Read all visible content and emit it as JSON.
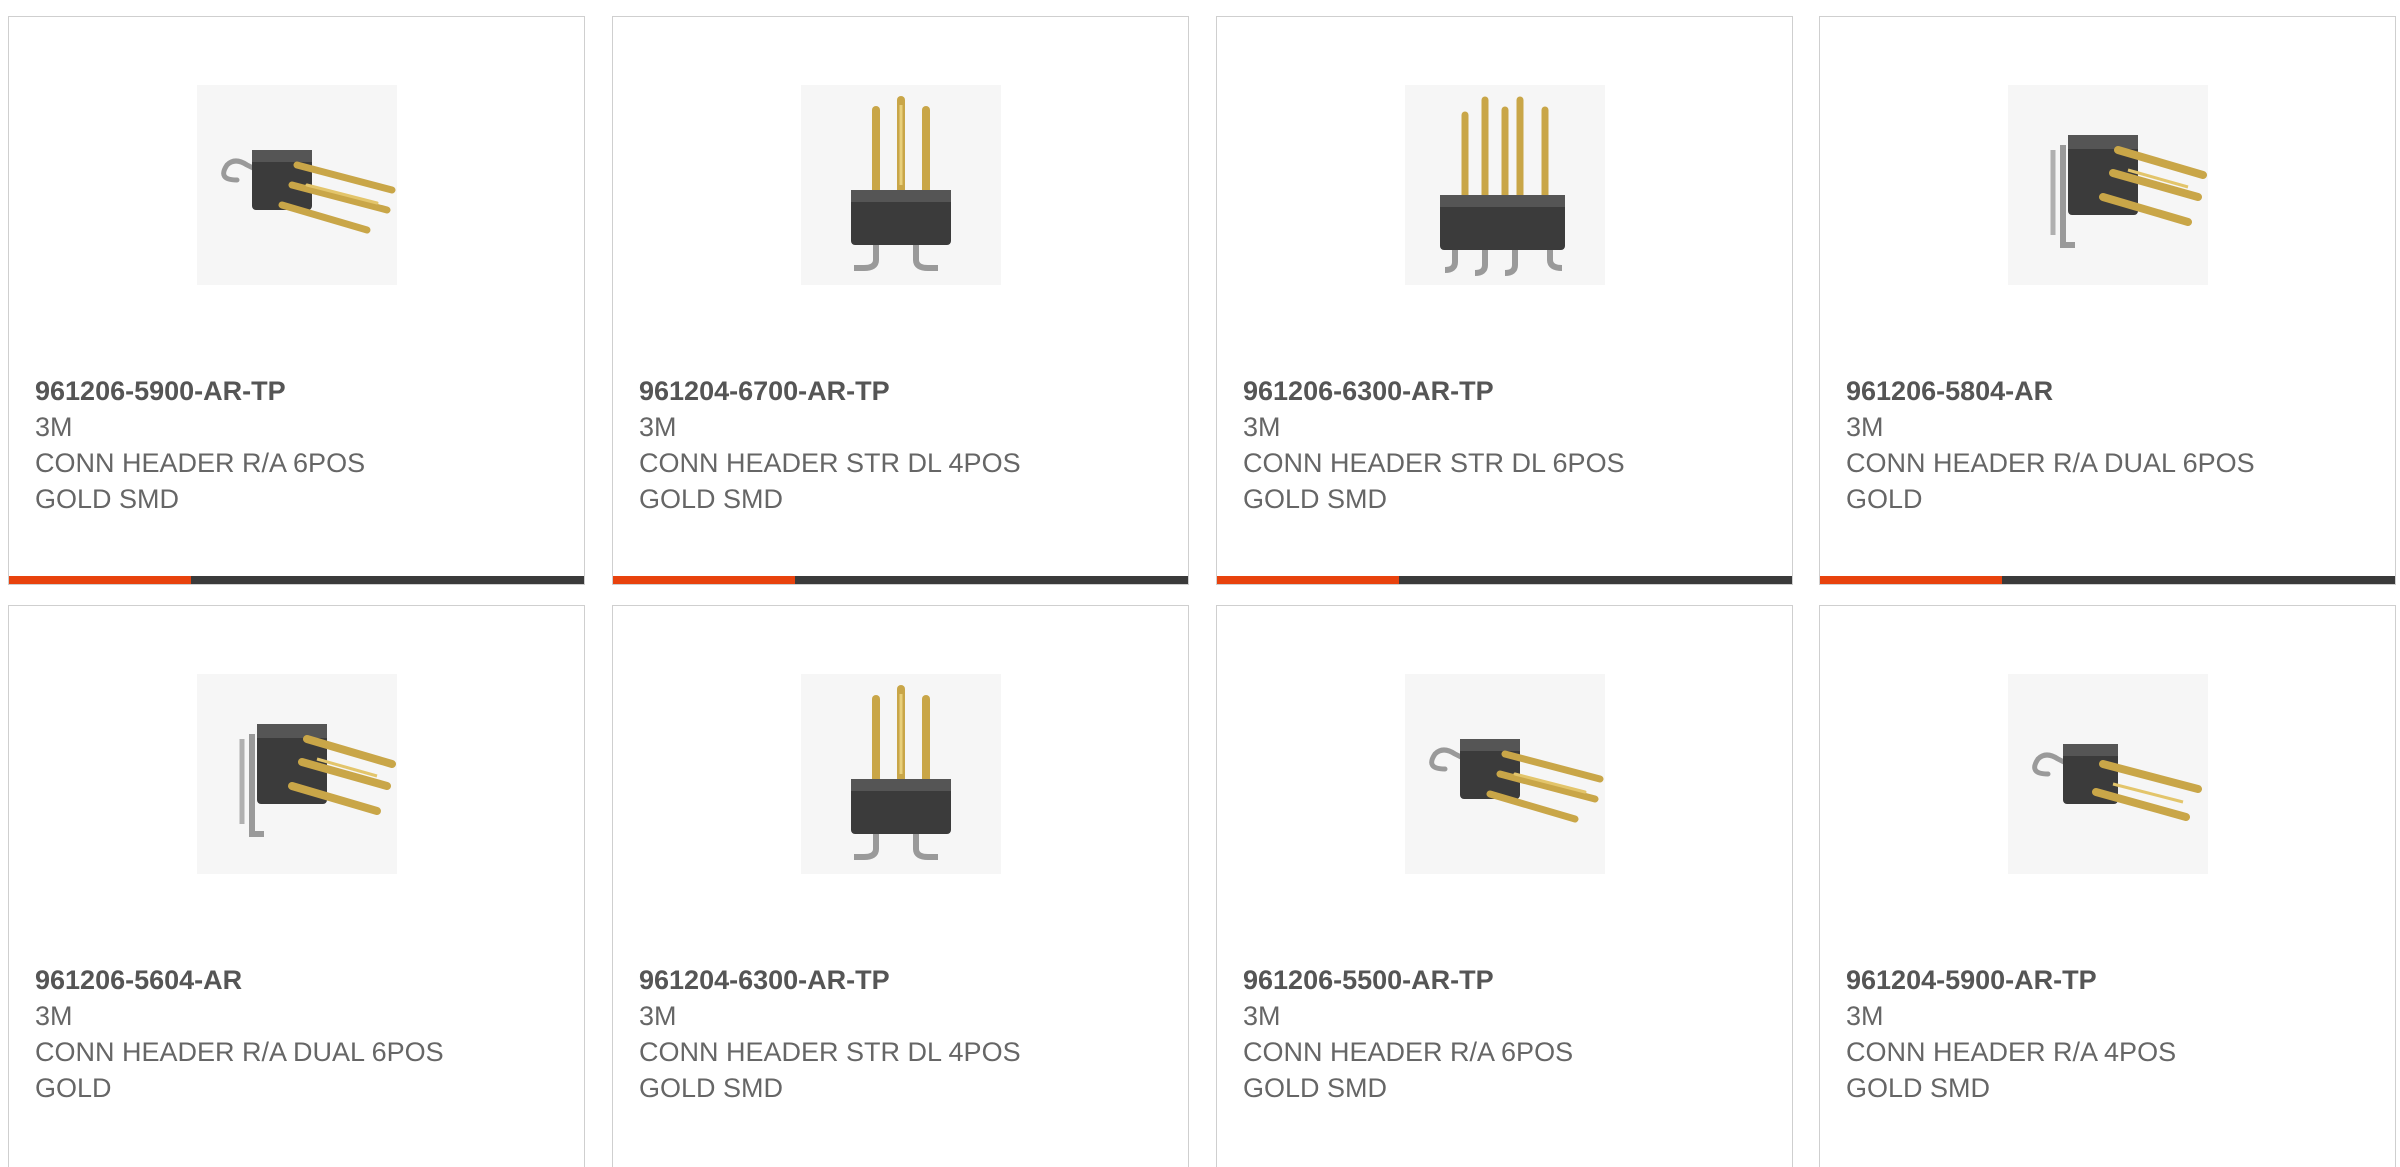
{
  "colors": {
    "accent": "#e8420d",
    "bar": "#3a3a3a",
    "border": "#cfcfcf",
    "text": "#666666"
  },
  "products": [
    {
      "part_number": "961206-5900-AR-TP",
      "manufacturer": "3M",
      "desc_line1": "CONN HEADER R/A 6POS",
      "desc_line2": "GOLD SMD",
      "image_icon": "right-angle-header-6pos-icon"
    },
    {
      "part_number": "961204-6700-AR-TP",
      "manufacturer": "3M",
      "desc_line1": "CONN HEADER STR DL 4POS",
      "desc_line2": "GOLD SMD",
      "image_icon": "straight-header-4pos-icon"
    },
    {
      "part_number": "961206-6300-AR-TP",
      "manufacturer": "3M",
      "desc_line1": "CONN HEADER STR DL 6POS",
      "desc_line2": "GOLD SMD",
      "image_icon": "straight-header-6pos-icon"
    },
    {
      "part_number": "961206-5804-AR",
      "manufacturer": "3M",
      "desc_line1": "CONN HEADER R/A DUAL 6POS",
      "desc_line2": "GOLD",
      "image_icon": "right-angle-header-dual-icon"
    },
    {
      "part_number": "961206-5604-AR",
      "manufacturer": "3M",
      "desc_line1": "CONN HEADER R/A DUAL 6POS",
      "desc_line2": "GOLD",
      "image_icon": "right-angle-header-dual-icon"
    },
    {
      "part_number": "961204-6300-AR-TP",
      "manufacturer": "3M",
      "desc_line1": "CONN HEADER STR DL 4POS",
      "desc_line2": "GOLD SMD",
      "image_icon": "straight-header-4pos-icon"
    },
    {
      "part_number": "961206-5500-AR-TP",
      "manufacturer": "3M",
      "desc_line1": "CONN HEADER R/A 6POS",
      "desc_line2": "GOLD SMD",
      "image_icon": "right-angle-header-6pos-icon"
    },
    {
      "part_number": "961204-5900-AR-TP",
      "manufacturer": "3M",
      "desc_line1": "CONN HEADER R/A 4POS",
      "desc_line2": "GOLD SMD",
      "image_icon": "right-angle-header-4pos-icon"
    }
  ]
}
